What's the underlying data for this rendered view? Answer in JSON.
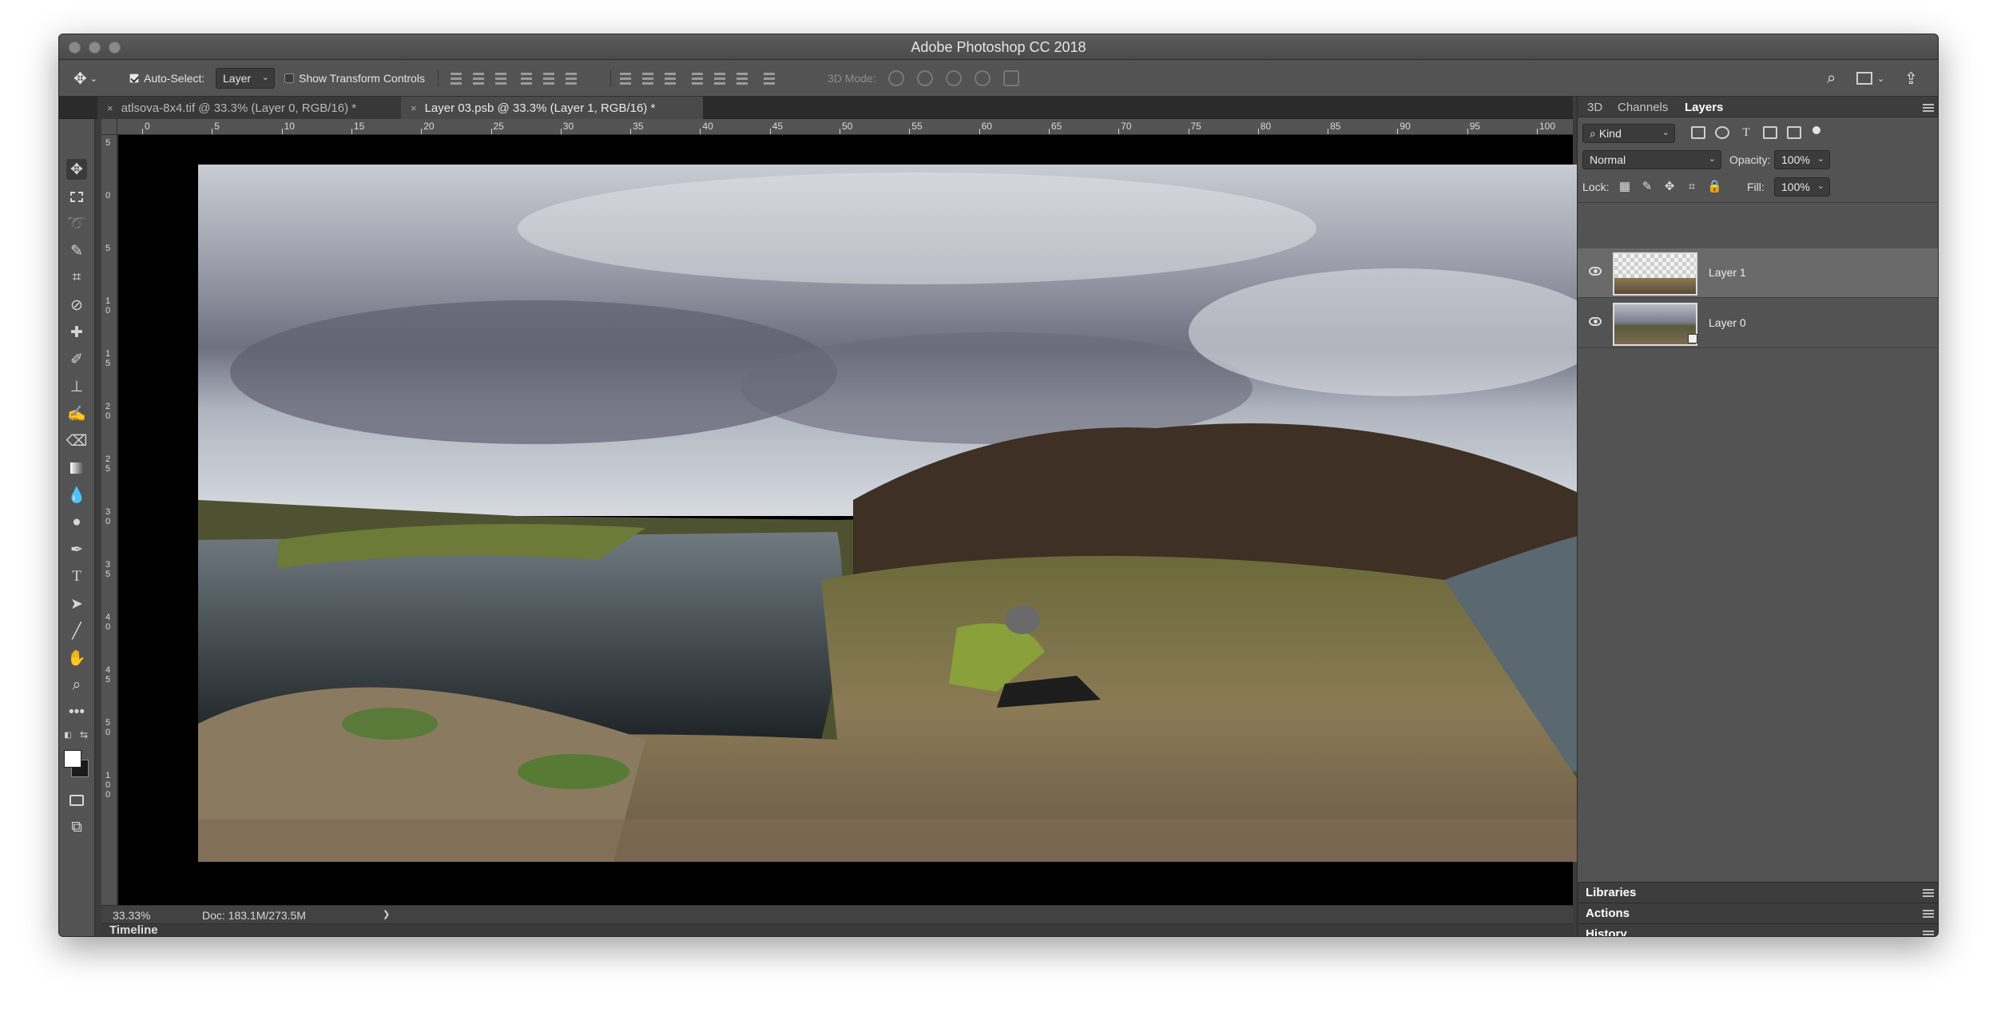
{
  "window": {
    "title": "Adobe Photoshop CC 2018"
  },
  "options": {
    "auto_select_label": "Auto-Select:",
    "auto_select_value": "Layer",
    "show_transform_label": "Show Transform Controls",
    "mode3d_label": "3D Mode:"
  },
  "tabs": [
    {
      "label": "atlsova-8x4.tif @ 33.3% (Layer 0, RGB/16) *"
    },
    {
      "label": "Layer 03.psb @ 33.3% (Layer 1, RGB/16) *"
    }
  ],
  "ruler": {
    "h_labels": [
      "0",
      "5",
      "10",
      "15",
      "20",
      "25",
      "30",
      "35",
      "40",
      "45",
      "50",
      "55",
      "60",
      "65",
      "70",
      "75",
      "80",
      "85",
      "90",
      "95",
      "100"
    ],
    "v_labels": [
      "5",
      "0",
      "5",
      "1 0",
      "1 5",
      "2 0",
      "2 5",
      "3 0",
      "3 5",
      "4 0",
      "4 5",
      "5 0",
      "1 0 0"
    ]
  },
  "status": {
    "zoom": "33.33%",
    "doc": "Doc: 183.1M/273.5M",
    "arrow": "❯"
  },
  "timeline": {
    "label": "Timeline"
  },
  "panel": {
    "tabs": [
      "3D",
      "Channels",
      "Layers"
    ],
    "kind_label": "Kind",
    "blend_mode": "Normal",
    "opacity_label": "Opacity:",
    "opacity_value": "100%",
    "lock_label": "Lock:",
    "fill_label": "Fill:",
    "fill_value": "100%",
    "layers": [
      {
        "name": "Layer 1"
      },
      {
        "name": "Layer 0"
      }
    ]
  },
  "collapsed_panels": [
    "Libraries",
    "Actions",
    "History"
  ]
}
